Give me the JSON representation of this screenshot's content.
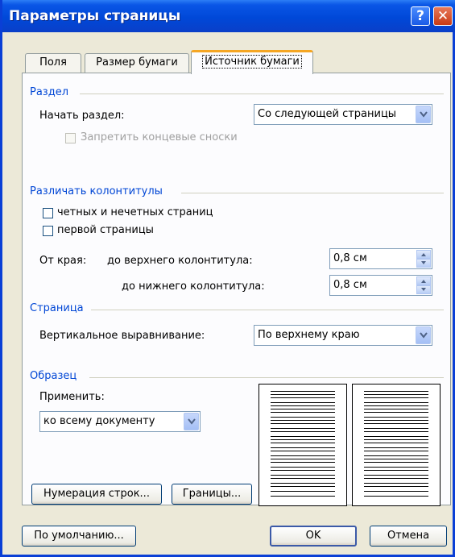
{
  "window": {
    "title": "Параметры страницы",
    "help_label": "?",
    "close_label": "✕"
  },
  "tabs": [
    {
      "label": "Поля",
      "active": false
    },
    {
      "label": "Размер бумаги",
      "active": false
    },
    {
      "label": "Источник бумаги",
      "active": true
    }
  ],
  "section": {
    "group_label": "Раздел",
    "start_label": "Начать раздел:",
    "start_value": "Со следующей страницы",
    "suppress_endnotes_label": "Запретить концевые сноски",
    "suppress_endnotes_checked": false
  },
  "headers": {
    "group_label": "Различать колонтитулы",
    "odd_even_label": "четных и нечетных страниц",
    "odd_even_checked": false,
    "first_page_label": "первой страницы",
    "first_page_checked": false,
    "from_edge_label": "От края:",
    "header_label": "до верхнего колонтитула:",
    "header_value": "0,8 см",
    "footer_label": "до нижнего колонтитула:",
    "footer_value": "0,8 см"
  },
  "page": {
    "group_label": "Страница",
    "valign_label": "Вертикальное выравнивание:",
    "valign_value": "По верхнему краю"
  },
  "preview": {
    "group_label": "Образец",
    "apply_label": "Применить:",
    "apply_value": "ко всему документу"
  },
  "buttons": {
    "line_numbers": "Нумерация строк...",
    "borders": "Границы...",
    "default": "По умолчанию...",
    "ok": "OK",
    "cancel": "Отмена"
  },
  "icons": {
    "dropdown": "chevron-down-icon",
    "spin_up": "spin-up-icon",
    "spin_down": "spin-down-icon"
  },
  "colors": {
    "title_bar": "#0a56e6",
    "group_label": "#0046d5",
    "tab_highlight": "#f5a623",
    "dialog_bg": "#ece9d8"
  }
}
